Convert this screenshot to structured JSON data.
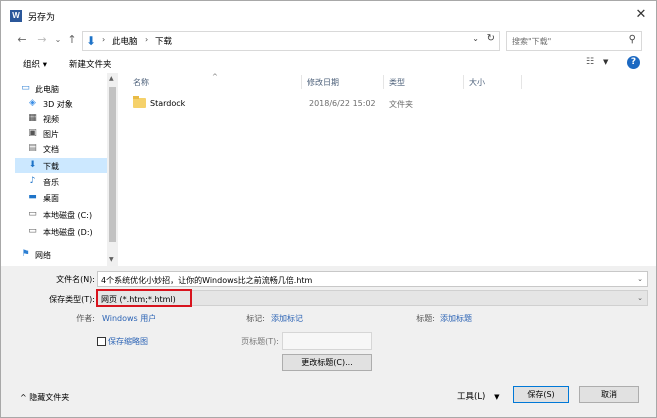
{
  "window": {
    "title": "另存为",
    "app_icon": "W",
    "close": "✕"
  },
  "navigation": {
    "back": "←",
    "forward": "→",
    "recent": "⌄",
    "up": "↑",
    "breadcrumb": [
      "此电脑",
      "下载"
    ],
    "search_placeholder": "搜索\"下载\""
  },
  "toolbar": {
    "organize": "组织 ▾",
    "new_folder": "新建文件夹"
  },
  "nav_pane": {
    "items": [
      {
        "label": "此电脑",
        "icon": "computer-icon"
      },
      {
        "label": "3D 对象",
        "icon": "3d-objects-icon"
      },
      {
        "label": "视频",
        "icon": "video-icon"
      },
      {
        "label": "图片",
        "icon": "pictures-icon"
      },
      {
        "label": "文档",
        "icon": "documents-icon"
      },
      {
        "label": "下载",
        "icon": "download-icon",
        "selected": true
      },
      {
        "label": "音乐",
        "icon": "music-icon"
      },
      {
        "label": "桌面",
        "icon": "desktop-icon"
      },
      {
        "label": "本地磁盘 (C:)",
        "icon": "drive-icon"
      },
      {
        "label": "本地磁盘 (D:)",
        "icon": "drive-icon"
      },
      {
        "label": "网络",
        "icon": "network-icon"
      }
    ]
  },
  "file_list": {
    "columns": [
      "名称",
      "修改日期",
      "类型",
      "大小"
    ],
    "rows": [
      {
        "name": "Stardock",
        "date": "2018/6/22 15:02",
        "type": "文件夹",
        "size": ""
      }
    ]
  },
  "form": {
    "filename_label": "文件名(N):",
    "filename_value": "4个系统优化小妙招，让你的Windows比之前流畅几倍.htm",
    "type_label": "保存类型(T):",
    "type_value": "网页 (*.htm;*.html)",
    "author_label": "作者:",
    "author_value": "Windows 用户",
    "tags_label": "标记:",
    "tags_value": "添加标记",
    "title_label": "标题:",
    "title_value": "添加标题",
    "thumbnail_label": "保存缩略图",
    "page_title_label": "页标题(T):",
    "change_title_button": "更改标题(C)..."
  },
  "footer": {
    "hide_folders": "隐藏文件夹",
    "tools": "工具(L)",
    "save": "保存(S)",
    "cancel": "取消"
  },
  "colors": {
    "selection": "#cce8ff",
    "link": "#2b63b5",
    "highlight_box": "#d8141e",
    "accent": "#0078d7"
  }
}
